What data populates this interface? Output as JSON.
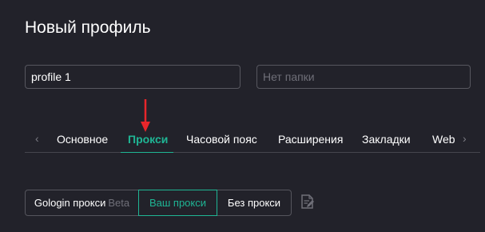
{
  "page": {
    "title": "Новый профиль"
  },
  "form": {
    "profile_name_value": "profile 1",
    "folder_placeholder": "Нет папки"
  },
  "tabs": {
    "items": [
      {
        "label": "Основное"
      },
      {
        "label": "Прокси"
      },
      {
        "label": "Часовой пояс"
      },
      {
        "label": "Расширения"
      },
      {
        "label": "Закладки"
      },
      {
        "label": "Web"
      }
    ],
    "active_index": 1,
    "scroll_left_glyph": "‹",
    "scroll_right_glyph": "›"
  },
  "proxy": {
    "gologin_label": "Gologin прокси",
    "gologin_badge": "Beta",
    "own_label": "Ваш прокси",
    "none_label": "Без прокси"
  },
  "icons": {
    "annotation_arrow": "red-down-arrow-icon",
    "notes": "edit-notes-icon"
  },
  "colors": {
    "background": "#22222a",
    "accent": "#1fb594",
    "border": "#55555d",
    "arrow": "#e8262b"
  }
}
